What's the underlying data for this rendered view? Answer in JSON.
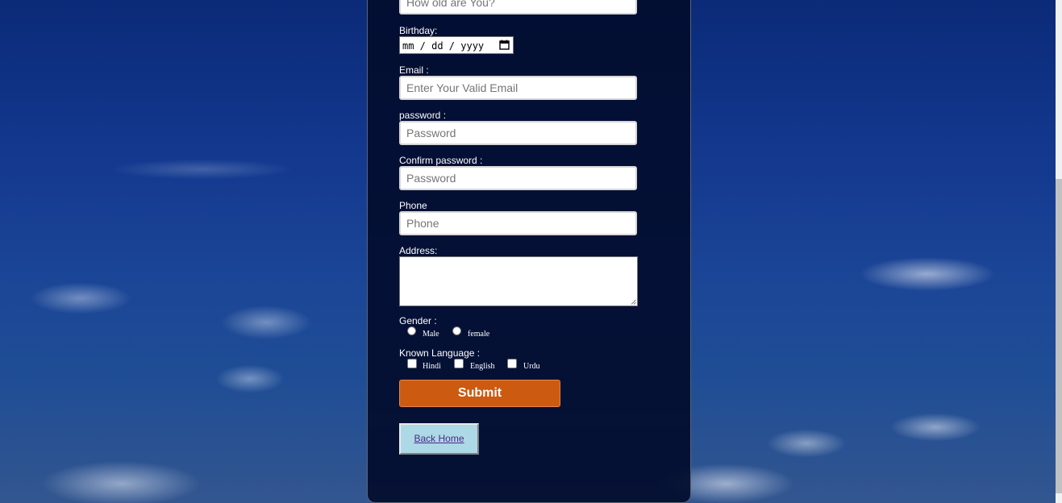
{
  "form": {
    "age": {
      "placeholder": "How old are You?"
    },
    "birthday": {
      "label": "Birthday:",
      "value": "mm / dd / yyyy"
    },
    "email": {
      "label": "Email :",
      "placeholder": "Enter Your Valid Email"
    },
    "password": {
      "label": "password :",
      "placeholder": "Password"
    },
    "confirm_password": {
      "label": "Confirm password :",
      "placeholder": "Password"
    },
    "phone": {
      "label": "Phone",
      "placeholder": "Phone"
    },
    "address": {
      "label": "Address:"
    },
    "gender": {
      "label": "Gender :",
      "options": [
        "Male",
        "female"
      ]
    },
    "languages": {
      "label": "Known Language :",
      "options": [
        "Hindi",
        "English",
        "Urdu"
      ]
    },
    "submit_label": "Submit",
    "back_home_label": "Back Home"
  },
  "icons": {
    "calendar": "calendar-icon"
  },
  "colors": {
    "panel_background": "#020c2d",
    "submit_button": "#cc5a10",
    "back_home_button": "#add8e6"
  }
}
